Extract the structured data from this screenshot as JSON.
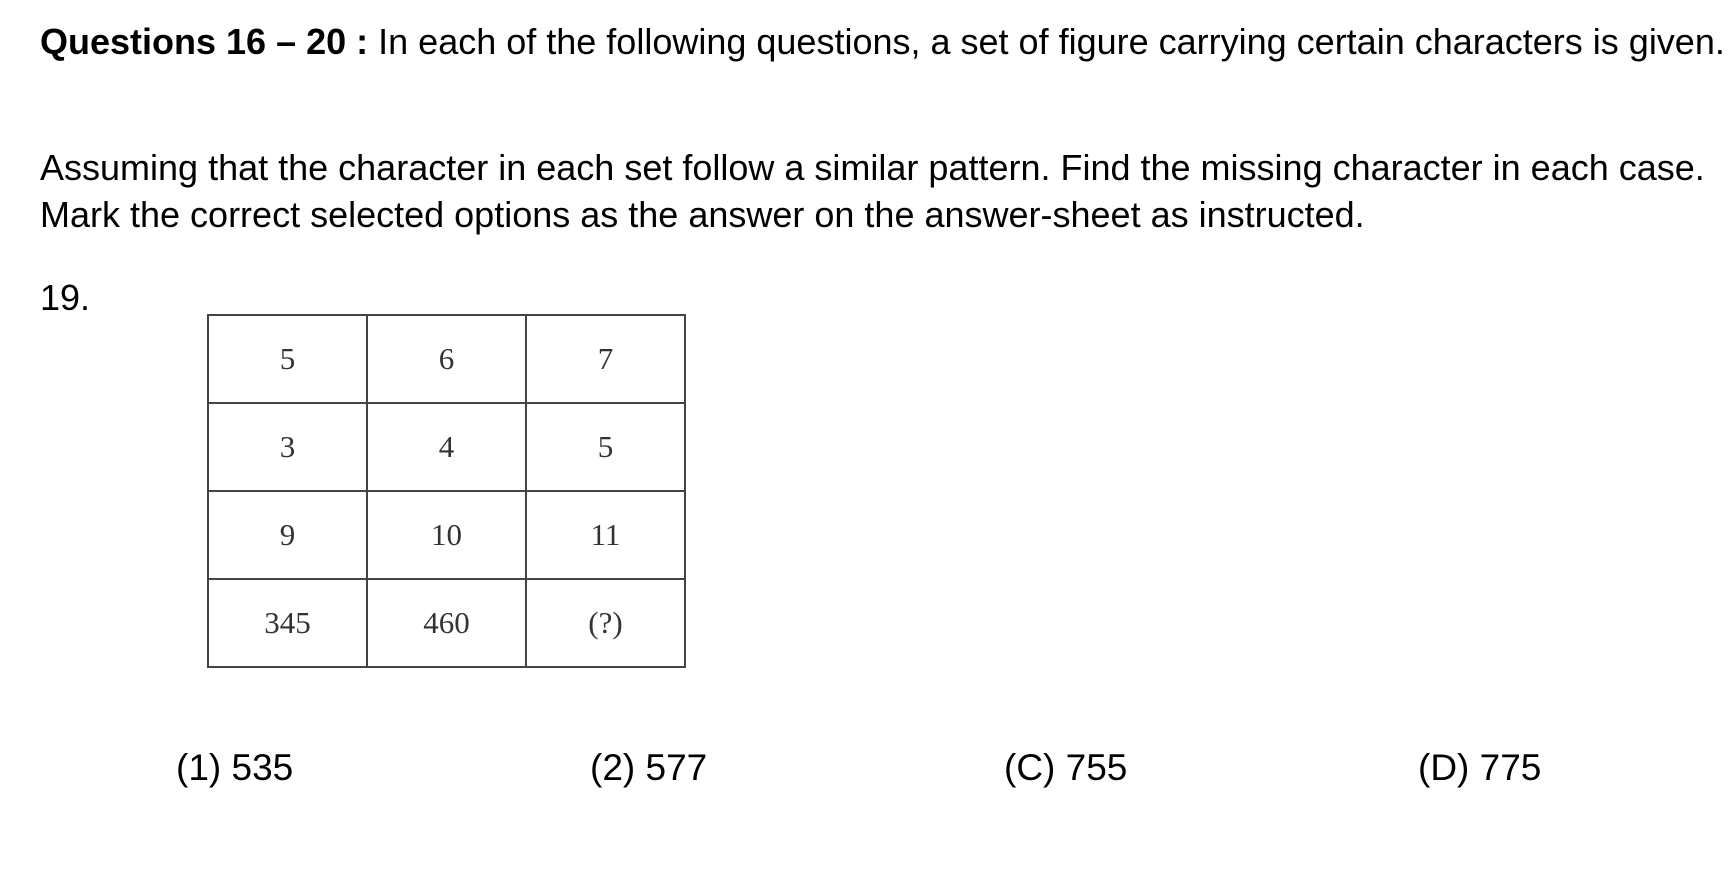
{
  "heading": {
    "bold_label": "Questions 16 – 20 :",
    "text": " In each of the following questions, a set of figure carrying certain characters is given."
  },
  "instruction": "Assuming that the character in each set follow a similar pattern. Find the missing character in each case. Mark the correct selected options as the answer on the answer-sheet as instructed.",
  "question": {
    "number": "19.",
    "grid": [
      [
        "5",
        "6",
        "7"
      ],
      [
        "3",
        "4",
        "5"
      ],
      [
        "9",
        "10",
        "11"
      ],
      [
        "345",
        "460",
        "(?)"
      ]
    ],
    "options": [
      "(1) 535",
      "(2) 577",
      "(C) 755",
      "(D) 775"
    ]
  }
}
